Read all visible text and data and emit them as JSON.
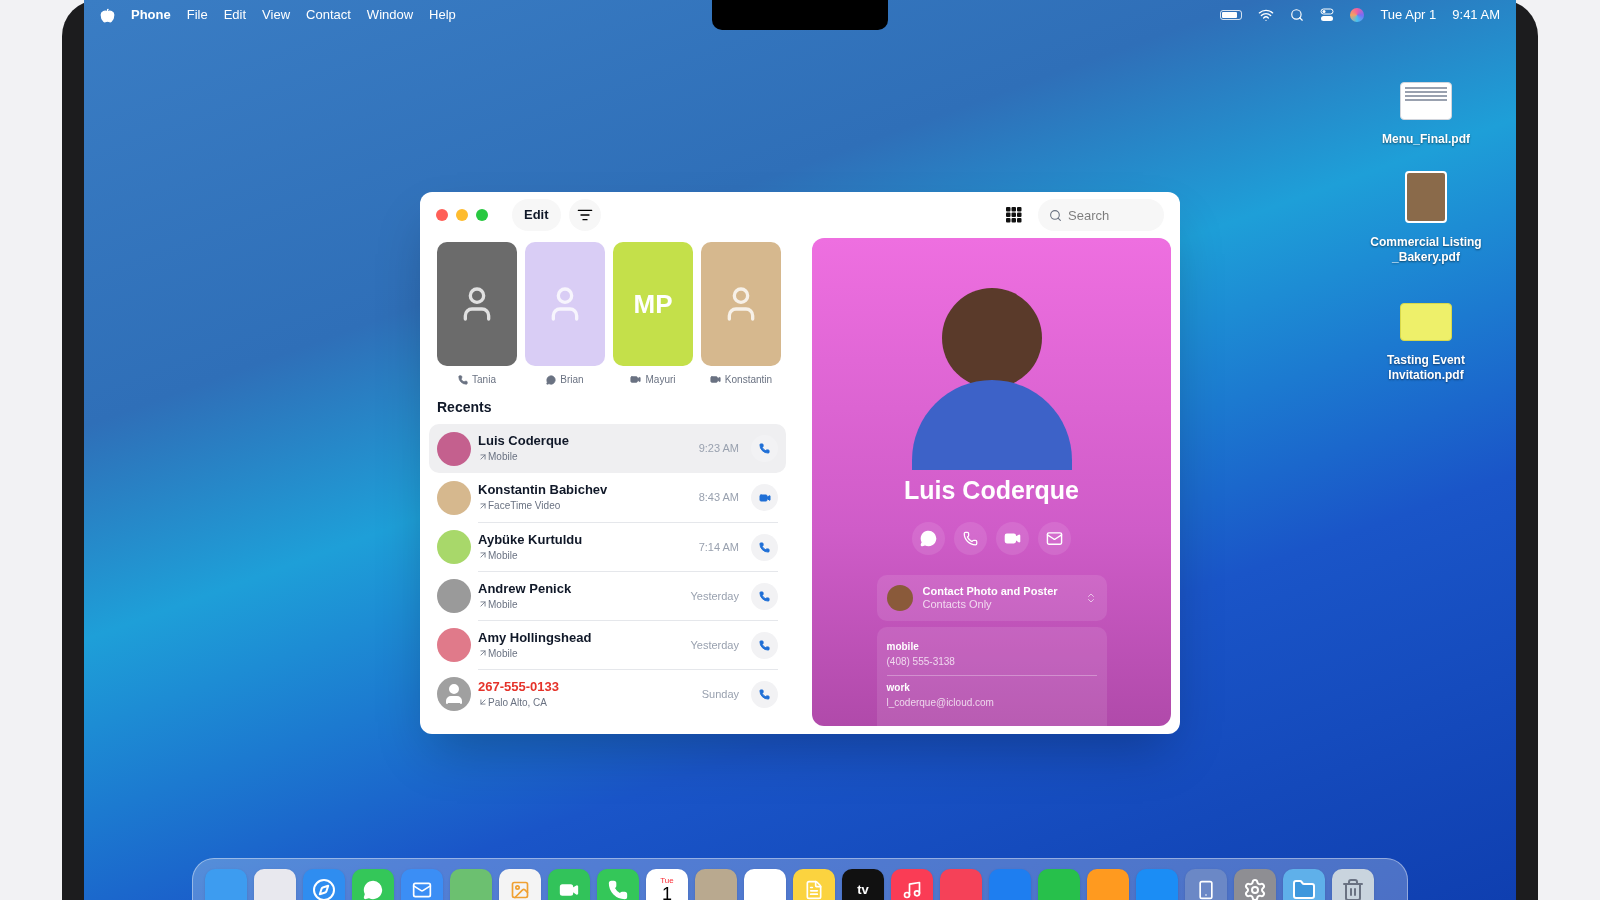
{
  "menu_bar": {
    "app_name": "Phone",
    "menus": [
      "File",
      "Edit",
      "View",
      "Contact",
      "Window",
      "Help"
    ],
    "date": "Tue Apr 1",
    "time": "9:41 AM"
  },
  "desktop_files": [
    {
      "name": "Menu_Final.pdf",
      "kind": "menu"
    },
    {
      "name": "Commercial Listing _Bakery.pdf",
      "kind": "photos"
    },
    {
      "name": "Tasting Event Invitation.pdf",
      "kind": "invite"
    }
  ],
  "window": {
    "toolbar": {
      "edit_button": "Edit",
      "search": {
        "placeholder": "Search"
      }
    },
    "favorites": [
      {
        "name": "Tania",
        "kind": "call",
        "color": "#6b6b6b"
      },
      {
        "name": "Brian",
        "kind": "message",
        "color": "#d9cdf5"
      },
      {
        "name": "Mayuri",
        "kind": "video",
        "color": "#c4e04a",
        "initials": "MP"
      },
      {
        "name": "Konstantin",
        "kind": "video",
        "color": "#d6b88e"
      }
    ],
    "recents_title": "Recents",
    "recents": [
      {
        "name": "Luis Coderque",
        "detail": "Mobile",
        "incoming": false,
        "time": "9:23 AM",
        "video": false,
        "missed": false,
        "selected": true,
        "color": "#c4608e"
      },
      {
        "name": "Konstantin Babichev",
        "detail": "FaceTime Video",
        "incoming": false,
        "time": "8:43 AM",
        "video": true,
        "missed": false,
        "selected": false,
        "color": "#d6b88e"
      },
      {
        "name": "Aybüke Kurtuldu",
        "detail": "Mobile",
        "incoming": false,
        "time": "7:14 AM",
        "video": false,
        "missed": false,
        "selected": false,
        "color": "#a8d86a"
      },
      {
        "name": "Andrew Penick",
        "detail": "Mobile",
        "incoming": false,
        "time": "Yesterday",
        "video": false,
        "missed": false,
        "selected": false,
        "color": "#9a9a9a"
      },
      {
        "name": "Amy Hollingshead",
        "detail": "Mobile",
        "incoming": false,
        "time": "Yesterday",
        "video": false,
        "missed": false,
        "selected": false,
        "color": "#e07a8a"
      },
      {
        "name": "267-555-0133",
        "detail": "Palo Alto, CA",
        "incoming": true,
        "time": "Sunday",
        "video": false,
        "missed": true,
        "selected": false,
        "color": "#a0a0a0",
        "unknown": true
      }
    ],
    "contact_card": {
      "name": "Luis Coderque",
      "actions": [
        {
          "kind": "message"
        },
        {
          "kind": "call"
        },
        {
          "kind": "video"
        },
        {
          "kind": "mail"
        }
      ],
      "poster": {
        "title": "Contact Photo and Poster",
        "subtitle": "Contacts Only"
      },
      "fields": [
        {
          "label": "mobile",
          "value": "(408) 555-3138"
        },
        {
          "label": "work",
          "value": "l_coderque@icloud.com"
        }
      ]
    }
  },
  "dock": [
    {
      "kind": "finder",
      "color": "#3d9cf0"
    },
    {
      "kind": "launchpad",
      "color": "#e8e8ee"
    },
    {
      "kind": "safari",
      "color": "#2f8df0"
    },
    {
      "kind": "messages",
      "color": "#34c759"
    },
    {
      "kind": "mail",
      "color": "#3b8ef5"
    },
    {
      "kind": "maps",
      "color": "#6cc070"
    },
    {
      "kind": "photos",
      "color": "#f4f4f4"
    },
    {
      "kind": "facetime",
      "color": "#32c35a"
    },
    {
      "kind": "phone",
      "color": "#34c759"
    },
    {
      "kind": "calendar",
      "color": "#ffffff",
      "top": "Tue",
      "big": "1"
    },
    {
      "kind": "contacts",
      "color": "#b9a98f"
    },
    {
      "kind": "reminders",
      "color": "#ffffff"
    },
    {
      "kind": "notes",
      "color": "#fbd33f"
    },
    {
      "kind": "tv",
      "color": "#111111",
      "big": "tv"
    },
    {
      "kind": "music",
      "color": "#fa3c55"
    },
    {
      "kind": "news",
      "color": "#f54158"
    },
    {
      "kind": "keynote",
      "color": "#1e7ef0"
    },
    {
      "kind": "numbers",
      "color": "#27c04b"
    },
    {
      "kind": "pages",
      "color": "#ff9a1f"
    },
    {
      "kind": "appstore",
      "color": "#1b8df5"
    },
    {
      "kind": "iphone",
      "color": "#6b88c6"
    },
    {
      "kind": "settings",
      "color": "#8e8e93"
    },
    {
      "kind": "downloads",
      "color": "#5fb0ea"
    },
    {
      "kind": "trash",
      "color": "#c9d4de"
    }
  ]
}
